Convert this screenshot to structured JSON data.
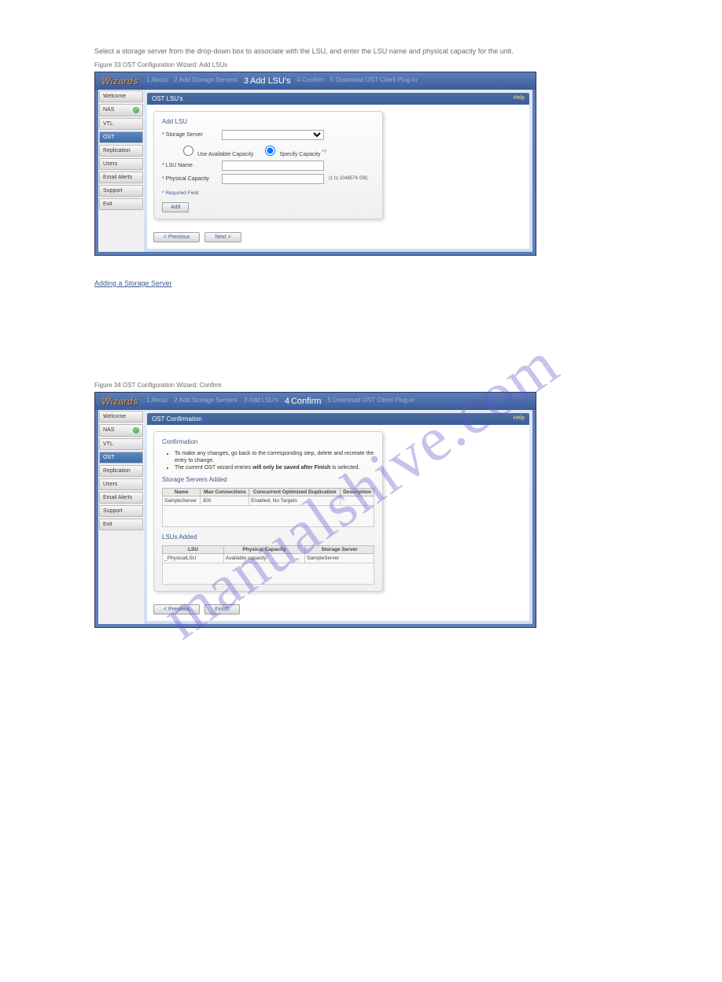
{
  "watermark": "manualshive.com",
  "descriptions": {
    "d1": "Select a storage server from the drop-down box to associate with the LSU, and enter the LSU name and physical capacity for the unit.",
    "figlabel1": "Figure 33 OST Configuration Wizard: Add LSUs",
    "link_text": "Adding a Storage Server",
    "figlabel2": "Figure 34 OST Configuration Wizard: Confirm"
  },
  "sidebar": {
    "items": [
      {
        "label": "Welcome",
        "checked": false,
        "active": false,
        "id": "welcome"
      },
      {
        "label": "NAS",
        "checked": true,
        "active": false,
        "id": "nas"
      },
      {
        "label": "VTL",
        "checked": false,
        "active": false,
        "id": "vtl"
      },
      {
        "label": "OST",
        "checked": false,
        "active": true,
        "id": "ost"
      },
      {
        "label": "Replication",
        "checked": false,
        "active": false,
        "id": "replication"
      },
      {
        "label": "Users",
        "checked": false,
        "active": false,
        "id": "users"
      },
      {
        "label": "Email Alerts",
        "checked": false,
        "active": false,
        "id": "emailalerts"
      },
      {
        "label": "Support",
        "checked": false,
        "active": false,
        "id": "support"
      },
      {
        "label": "Exit",
        "checked": false,
        "active": false,
        "id": "exit"
      }
    ]
  },
  "breadcrumb": {
    "wizards": "Wizards",
    "steps": [
      {
        "num": "1",
        "label": "About"
      },
      {
        "num": "2",
        "label": "Add Storage Servers"
      },
      {
        "num": "3",
        "label": "Add LSU's"
      },
      {
        "num": "4",
        "label": "Confirm"
      },
      {
        "num": "5",
        "label": "Download OST Client Plug-in"
      }
    ]
  },
  "app1": {
    "panel_title": "OST LSU's",
    "help": "Help",
    "section": "Add LSU",
    "storage_server_label": "Storage Server",
    "use_avail_label": "Use Available Capacity",
    "specify_label": "Specify Capacity",
    "lsu_name_label": "LSU Name",
    "phys_cap_label": "Physical Capacity",
    "cap_hint": "(1 to 1048576 GB)",
    "required": "* Required Field",
    "add_btn": "Add",
    "prev": "< Previous",
    "next": "Next >",
    "active_step": 2
  },
  "app2": {
    "panel_title": "OST Confirmation",
    "help": "Help",
    "section": "Confirmation",
    "bullets": [
      "To make any changes, go back to the corresponding step, delete and recreate the entry to change.",
      "The current OST wizard entries "
    ],
    "bullet2_bold": "will only be saved after Finish",
    "bullet2_tail": " is selected.",
    "servers_added": "Storage Servers Added",
    "servers_table": {
      "headers": [
        "Name",
        "Max Connections",
        "Concurrent Optimized Duplication",
        "Description"
      ],
      "row": [
        "SampleServer",
        "300",
        "Enabled, No Targets",
        ""
      ]
    },
    "lsus_added": "LSUs Added",
    "lsus_table": {
      "headers": [
        "LSU",
        "Physical Capacity",
        "Storage Server"
      ],
      "row": [
        "_PhysicalLSU",
        "Available capacity",
        "SampleServer"
      ]
    },
    "prev": "< Previous",
    "finish": "Finish",
    "active_step": 3
  }
}
